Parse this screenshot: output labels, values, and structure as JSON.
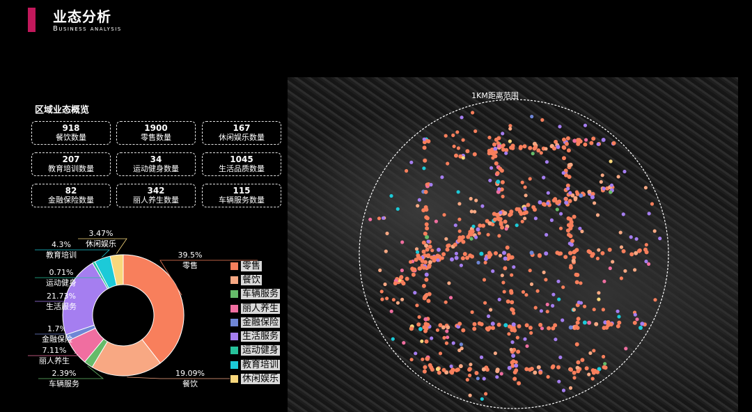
{
  "header": {
    "title": "业态分析",
    "subtitle": "Business analysis",
    "accent_color": "#c2185b"
  },
  "overview": {
    "title": "区域业态概览",
    "stats": [
      {
        "value": "918",
        "label": "餐饮数量"
      },
      {
        "value": "1900",
        "label": "零售数量"
      },
      {
        "value": "167",
        "label": "休闲娱乐数量"
      },
      {
        "value": "207",
        "label": "教育培训数量"
      },
      {
        "value": "34",
        "label": "运动健身数量"
      },
      {
        "value": "1045",
        "label": "生活品质数量"
      },
      {
        "value": "82",
        "label": "金融保险数量"
      },
      {
        "value": "342",
        "label": "丽人养生数量"
      },
      {
        "value": "115",
        "label": "车辆服务数量"
      }
    ]
  },
  "chart_data": {
    "type": "pie",
    "donut": true,
    "categories": [
      "零售",
      "餐饮",
      "车辆服务",
      "丽人养生",
      "金融保险",
      "生活服务",
      "运动健身",
      "教育培训",
      "休闲娱乐"
    ],
    "values": [
      39.5,
      19.09,
      2.39,
      7.11,
      1.7,
      21.73,
      0.71,
      4.3,
      3.47
    ],
    "percent_labels": [
      "39.5%",
      "19.09%",
      "2.39%",
      "7.11%",
      "1.7%",
      "21.73%",
      "0.71%",
      "4.3%",
      "3.47%"
    ],
    "colors": [
      "#f87f5c",
      "#f8a883",
      "#66bb6a",
      "#f06ea0",
      "#6f86d6",
      "#a57ef0",
      "#27c29b",
      "#1ccad8",
      "#f8d77c"
    ],
    "legend_placement": "right"
  },
  "map": {
    "range_label": "1KM距离范围"
  }
}
